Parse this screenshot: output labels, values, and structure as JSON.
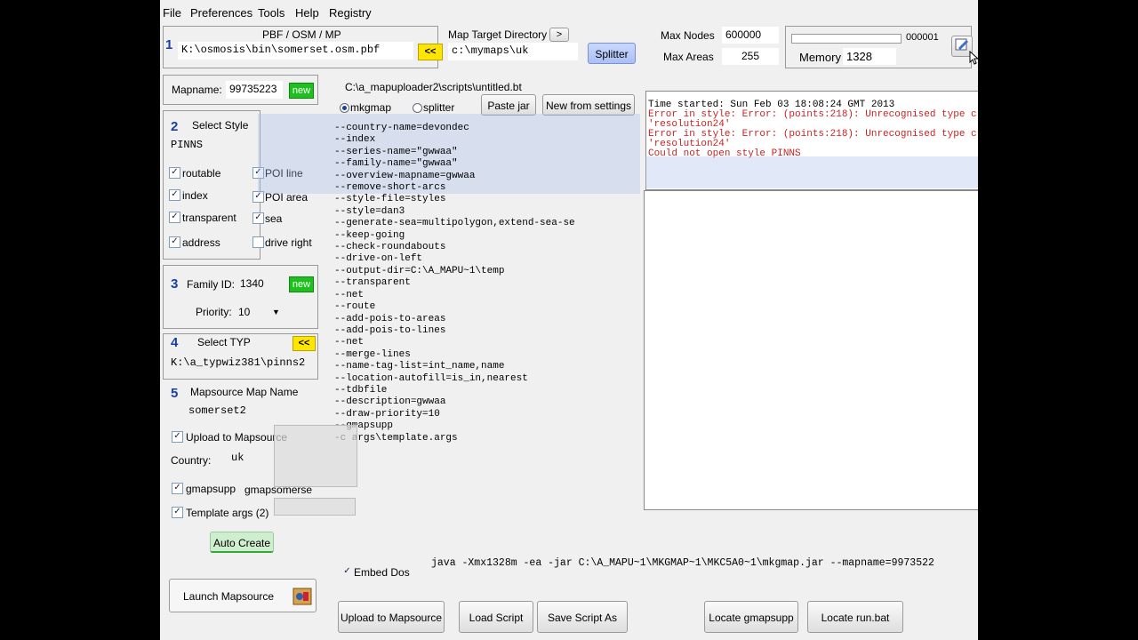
{
  "menu": [
    "File",
    "Preferences",
    "Tools",
    "Help",
    "Registry"
  ],
  "input": {
    "header": "PBF / OSM / MP",
    "path": "K:\\osmosis\\bin\\somerset.osm.pbf",
    "browse": "<<"
  },
  "target": {
    "label": "Map Target Directory",
    "arrow": ">",
    "path": "c:\\mymaps\\uk"
  },
  "splitter_btn": "Splitter",
  "max_nodes": {
    "label": "Max Nodes",
    "value": "600000"
  },
  "max_areas": {
    "label": "Max Areas",
    "value": "255"
  },
  "progress": {
    "count": "000001",
    "fraction": 0.0
  },
  "memory": {
    "label": "Memory",
    "value": "1328"
  },
  "step": [
    "1",
    "2",
    "3",
    "4",
    "5"
  ],
  "mapname": {
    "label": "Mapname:",
    "value": "99735223",
    "new": "new"
  },
  "script_path": "C:\\a_mapuploader2\\scripts\\untitled.bt",
  "radio": {
    "mkgmap": "mkgmap",
    "splitter": "splitter"
  },
  "buttons": {
    "paste_jar": "Paste jar",
    "new_from_settings": "New from settings",
    "auto_create": "Auto Create",
    "launch": "Launch Mapsource",
    "upload": "Upload to Mapsource",
    "load_script": "Load Script",
    "save_script": "Save Script As",
    "locate_gmapsupp": "Locate gmapsupp",
    "locate_run": "Locate run.bat"
  },
  "style": {
    "title": "Select Style",
    "value": "PINNS",
    "checks": [
      {
        "label": "routable",
        "checked": true
      },
      {
        "label": "index",
        "checked": true
      },
      {
        "label": "transparent",
        "checked": true
      },
      {
        "label": "address",
        "checked": true
      }
    ],
    "checks2": [
      {
        "label": "POI line",
        "checked": true
      },
      {
        "label": "POI area",
        "checked": true
      },
      {
        "label": "sea",
        "checked": true
      },
      {
        "label": "drive right",
        "checked": false
      }
    ]
  },
  "family": {
    "label": "Family ID:",
    "value": "1340",
    "new": "new",
    "priority_label": "Priority:",
    "priority": "10"
  },
  "typ": {
    "title": "Select TYP",
    "browse": "<<",
    "path": "K:\\a_typwiz381\\pinns2"
  },
  "mapsource": {
    "title": "Mapsource Map Name",
    "value": "somerset2"
  },
  "upload": {
    "label": "Upload to Mapsource",
    "checked": true
  },
  "country": {
    "label": "Country:",
    "value": "uk"
  },
  "gmapsupp": {
    "label": "gmapsupp",
    "checked": true,
    "value": "gmapsomerse"
  },
  "template": {
    "label": "Template args (2)",
    "checked": true
  },
  "embed": {
    "label": "Embed Dos",
    "checked": true
  },
  "args_lines": [
    "--country-name=devondec",
    "--index",
    "--series-name=\"gwwaa\"",
    "--family-name=\"gwwaa\"",
    "--overview-mapname=gwwaa",
    "--remove-short-arcs",
    "--style-file=styles",
    "--style=dan3",
    "--generate-sea=multipolygon,extend-sea-se",
    "--keep-going",
    "--check-roundabouts",
    "--drive-on-left",
    "--output-dir=C:\\A_MAPU~1\\temp",
    "--transparent",
    "--net",
    "--route",
    "--add-pois-to-areas",
    "--add-pois-to-lines",
    "--net",
    "--merge-lines",
    "--name-tag-list=int_name,name",
    "--location-autofill=is_in,nearest",
    "--tdbfile",
    "--description=gwwaa",
    "--draw-priority=10",
    "--gmapsupp",
    "-c args\\template.args"
  ],
  "log": {
    "lines": [
      {
        "text": "Time started: Sun Feb 03 18:08:24 GMT 2013",
        "color": "#000000"
      },
      {
        "text": "Error in style: Error: (points:218): Unrecognised type c",
        "color": "#cc2222"
      },
      {
        "text": "'resolution24'",
        "color": "#cc2222"
      },
      {
        "text": "Error in style: Error: (points:218): Unrecognised type c",
        "color": "#cc2222"
      },
      {
        "text": "'resolution24'",
        "color": "#cc2222"
      },
      {
        "text": "Could not open style PINNS",
        "color": "#cc2222"
      }
    ]
  },
  "command": "java -Xmx1328m -ea -jar C:\\A_MAPU~1\\MKGMAP~1\\MKC5A0~1\\mkgmap.jar --mapname=9973522",
  "icons": [
    "edit-icon",
    "cursor-icon",
    "mapsource-icon"
  ]
}
